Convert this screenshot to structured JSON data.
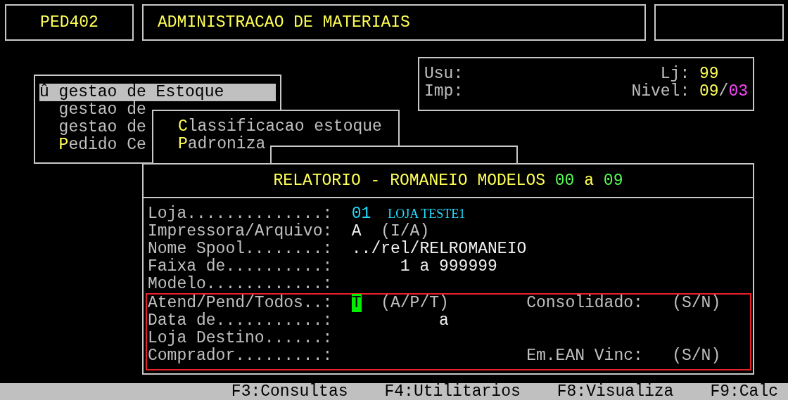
{
  "header": {
    "program_code": "PED402",
    "system_title": "ADMINISTRACAO DE MATERIAIS"
  },
  "user_panel": {
    "user_label": "Usu:",
    "printer_label": "Imp:",
    "store_label": "Lj:",
    "store_value": "99",
    "level_label": "Nivel:",
    "level_value": "09",
    "level_separator": "/",
    "level_max": "03"
  },
  "main_menu": {
    "items": [
      {
        "marker": "û",
        "label": "gestao de Estoque",
        "selected": true,
        "hotkey": false
      },
      {
        "label": "gestao de",
        "selected": false,
        "hotkey": false
      },
      {
        "label": "gestao de",
        "selected": false,
        "hotkey": false
      },
      {
        "label": "Pedido Ce",
        "selected": false,
        "hotkey": true
      }
    ]
  },
  "submenu": {
    "items": [
      {
        "label": "Classificacao estoque",
        "hotkey": true
      },
      {
        "label": "Padroniza",
        "hotkey": true
      }
    ]
  },
  "report": {
    "title": "RELATORIO - ROMANEIO MODELOS",
    "range_from": "00",
    "range_sep": "a",
    "range_to": "09",
    "fields": [
      {
        "kind": "store",
        "label": "Loja..............:",
        "value": "01",
        "detail": "LOJA TESTE1"
      },
      {
        "kind": "choice",
        "label": "Impressora/Arquivo:",
        "value": "A",
        "hint": "(I/A)"
      },
      {
        "kind": "text",
        "label": "Nome Spool........:",
        "value": "../rel/RELROMANEIO"
      },
      {
        "kind": "range",
        "label": "Faixa de..........:",
        "from": "1",
        "sep": "a",
        "to": "999999"
      },
      {
        "kind": "text",
        "label": "Modelo............:"
      }
    ],
    "filter_group": {
      "fields": [
        {
          "kind": "choice",
          "label": "Atend/Pend/Todos..:",
          "value": "T",
          "focused": true,
          "hint": "(A/P/T)",
          "side_label": "Consolidado:",
          "side_hint": "(S/N)"
        },
        {
          "kind": "date_range",
          "label": "Data de...........:",
          "sep": "a"
        },
        {
          "kind": "text",
          "label": "Loja Destino......:"
        },
        {
          "kind": "text",
          "label": "Comprador.........:",
          "side_label": "Em.EAN Vinc:",
          "side_hint": "(S/N)"
        }
      ]
    }
  },
  "function_bar": {
    "keys": [
      "F3:Consultas",
      "F4:Utilitarios",
      "F8:Visualiza",
      "F9:Calc"
    ]
  }
}
